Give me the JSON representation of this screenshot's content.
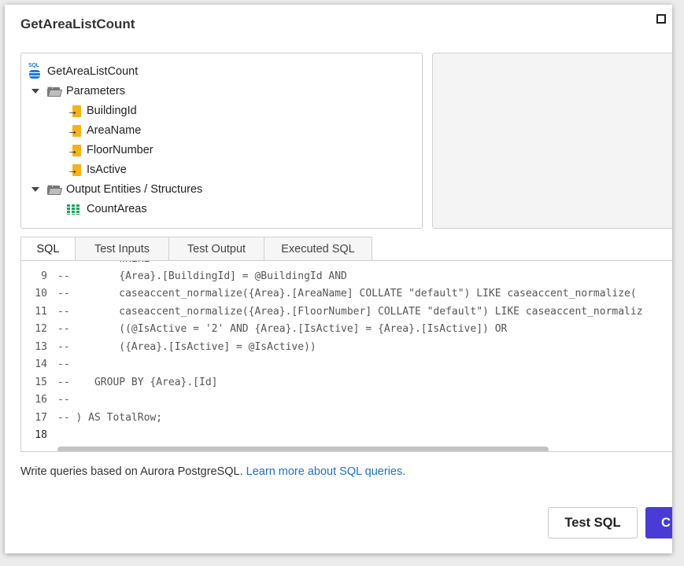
{
  "dialog": {
    "title": "GetAreaListCount"
  },
  "tree": {
    "root_label": "GetAreaListCount",
    "root_icon": "sql-database-icon",
    "parameters_label": "Parameters",
    "parameters": [
      "BuildingId",
      "AreaName",
      "FloorNumber",
      "IsActive"
    ],
    "outputs_label": "Output Entities / Structures",
    "outputs": [
      "CountAreas"
    ]
  },
  "tabs": [
    "SQL",
    "Test Inputs",
    "Test Output",
    "Executed SQL"
  ],
  "active_tab": "SQL",
  "editor": {
    "lines": [
      {
        "n": "9",
        "text": "--        {Area}.[BuildingId] = @BuildingId AND"
      },
      {
        "n": "10",
        "text": "--        caseaccent_normalize({Area}.[AreaName] COLLATE \"default\") LIKE caseaccent_normalize("
      },
      {
        "n": "11",
        "text": "--        caseaccent_normalize({Area}.[FloorNumber] COLLATE \"default\") LIKE caseaccent_normaliz"
      },
      {
        "n": "12",
        "text": "--        ((@IsActive = '2' AND {Area}.[IsActive] = {Area}.[IsActive]) OR"
      },
      {
        "n": "13",
        "text": "--        ({Area}.[IsActive] = @IsActive))"
      },
      {
        "n": "14",
        "text": "--"
      },
      {
        "n": "15",
        "text": "--    GROUP BY {Area}.[Id]"
      },
      {
        "n": "16",
        "text": "--"
      },
      {
        "n": "17",
        "text": "-- ) AS TotalRow;"
      },
      {
        "n": "18",
        "text": ""
      }
    ],
    "current_line": "18"
  },
  "helper": {
    "text": "Write queries based on Aurora PostgreSQL. ",
    "link": "Learn more about SQL queries."
  },
  "buttons": {
    "test_sql": "Test SQL",
    "primary": "C"
  },
  "colors": {
    "primary": "#4a3bd6",
    "link": "#1f6fd1",
    "param_icon": "#f6b21b",
    "table_icon": "#1aa35b",
    "sql_icon": "#1d7ad6"
  }
}
